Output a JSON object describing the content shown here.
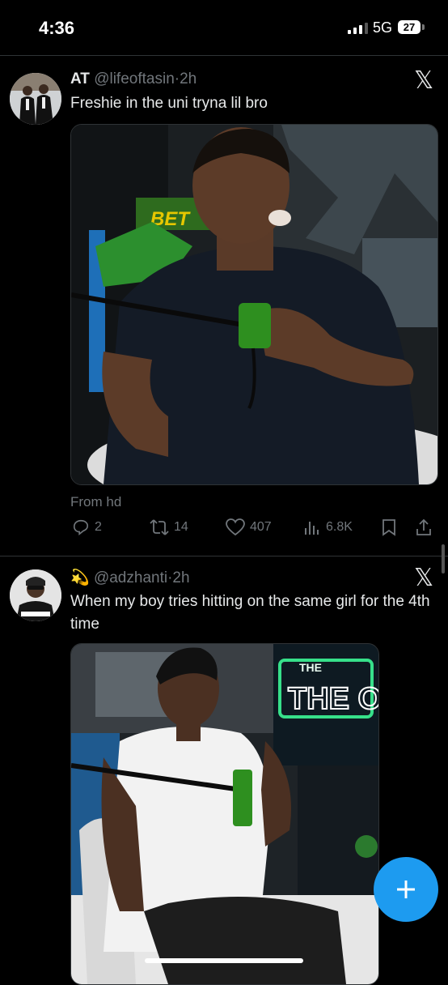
{
  "status_bar": {
    "time": "4:36",
    "network": "5G",
    "battery": "27"
  },
  "posts": [
    {
      "name": "AT",
      "handle": "@lifeoftasin",
      "time": "2h",
      "text": "Freshie in the uni tryna lil bro",
      "source": "From hd",
      "replies": "2",
      "reposts": "14",
      "likes": "407",
      "views": "6.8K"
    },
    {
      "name": "💫",
      "handle": "@adzhanti",
      "time": "2h",
      "text": "When my boy tries hitting on the same girl for the 4th time",
      "media_sign": "THE OBI"
    }
  ],
  "colors": {
    "accent": "#1d9bf0",
    "muted": "#71767b",
    "text": "#e7e9ea",
    "background": "#000000"
  }
}
